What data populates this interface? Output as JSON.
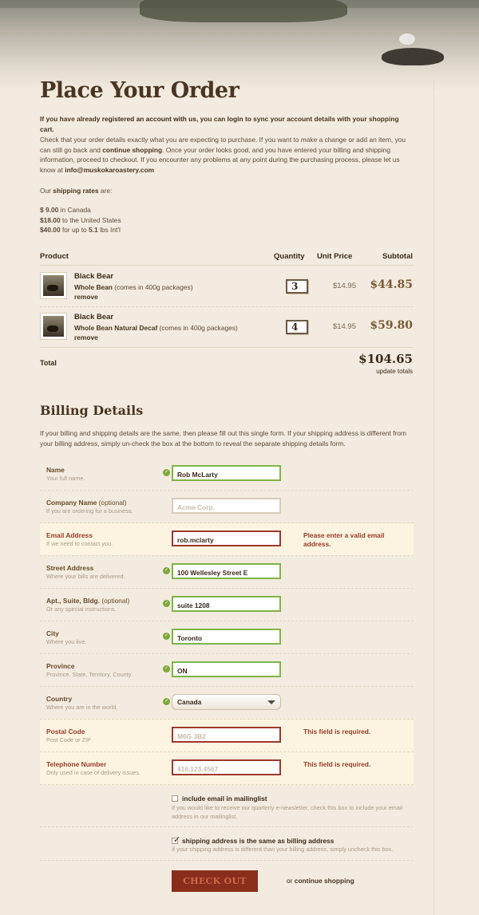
{
  "title": "Place Your Order",
  "intro": {
    "account_pre": "If you have already ",
    "account_link": "registered an account with us",
    "account_mid": ", you can ",
    "account_link2": "login",
    "account_post": " to sync your account details with your shopping cart.",
    "check_pre": "Check that your order details exactly what you are expecting to purchase. If you want to make a change or add an item, you can still go back and ",
    "check_link": "continue shopping",
    "check_mid": ". Once your order looks good, and you have entered your billing and shipping information, proceed to checkout. If you encounter any problems at any point during the purchasing process, please let us know at ",
    "check_email": "info@muskokaroastery.com",
    "rates_pre": "Our ",
    "rates_link": "shipping rates",
    "rates_post": " are:"
  },
  "rates": [
    {
      "amount": "$  9.00",
      "text": " in Canada"
    },
    {
      "amount": "$18.00",
      "text": " to the United States"
    },
    {
      "amount": "$40.00",
      "text": " for up to ",
      "extra": "5.1",
      "tail": " lbs Int'l"
    }
  ],
  "cart": {
    "headers": {
      "product": "Product",
      "quantity": "Quantity",
      "unit_price": "Unit Price",
      "subtotal": "Subtotal"
    },
    "items": [
      {
        "name": "Black Bear",
        "variant": "Whole Bean",
        "note": " (comes in 400g packages)",
        "remove": "remove",
        "qty": "3",
        "unit_price": "$14.95",
        "subtotal": "$44.85"
      },
      {
        "name": "Black Bear",
        "variant": "Whole Bean Natural Decaf",
        "note": " (comes in 400g packages)",
        "remove": "remove",
        "qty": "4",
        "unit_price": "$14.95",
        "subtotal": "$59.80"
      }
    ],
    "total_label": "Total",
    "total": "$104.65",
    "update": "update totals"
  },
  "billing": {
    "title": "Billing Details",
    "intro": "If your billing and shipping details are the same, then please fill out this single form. If your shipping address is different from your billing address, simply un-check the box at the bottom to reveal the separate shipping details form.",
    "fields": [
      {
        "label": "Name",
        "optional": "",
        "hint": "Your full name.",
        "value": "Rob McLarty",
        "state": "good",
        "error": ""
      },
      {
        "label": "Company Name",
        "optional": " (optional)",
        "hint": "If you are ordering for a business.",
        "value": "Acme Corp.",
        "state": "plain",
        "error": ""
      },
      {
        "label": "Email Address",
        "optional": "",
        "hint": "If we need to contact you.",
        "value": "rob.mclarty",
        "state": "bad",
        "error": "Please enter a valid email address."
      },
      {
        "label": "Street Address",
        "optional": "",
        "hint": "Where your bills are delivered.",
        "value": "100 Wellesley Street E",
        "state": "good",
        "error": ""
      },
      {
        "label": "Apt., Suite, Bldg.",
        "optional": " (optional)",
        "hint": "Or any special instructions.",
        "value": "suite 1208",
        "state": "good",
        "error": ""
      },
      {
        "label": "City",
        "optional": "",
        "hint": "Where you live.",
        "value": "Toronto",
        "state": "good",
        "error": ""
      },
      {
        "label": "Province",
        "optional": "",
        "hint": "Province, State, Territory, County.",
        "value": "ON",
        "state": "good",
        "error": ""
      },
      {
        "label": "Country",
        "optional": "",
        "hint": "Where you are in the world.",
        "value": "Canada",
        "state": "select",
        "error": ""
      },
      {
        "label": "Postal Code",
        "optional": "",
        "hint": "Post Code or ZIP",
        "value": "M6G 3B2",
        "state": "bad-ph",
        "error": "This field is required."
      },
      {
        "label": "Telephone Number",
        "optional": "",
        "hint": "Only used in case of delivery issues.",
        "value": "416.123.4567",
        "state": "bad-ph",
        "error": "This field is required."
      }
    ],
    "mailinglist_label": "include email in mailinglist",
    "mailinglist_hint": "If you would like to receive our quarterly e-newsletter, check this box to include your email address in our mailinglist.",
    "mailinglist_checked": false,
    "same_label": "shipping address is the same as billing address",
    "same_hint": "If your shipping address is different than your billing address, simply uncheck this box.",
    "same_checked": true,
    "checkout": "CHECK OUT",
    "or": "or ",
    "continue": "continue shopping"
  },
  "colors": {
    "accent": "#4a3422",
    "error": "#9a3a2a",
    "valid": "#7fb446",
    "button": "#8a2e1c"
  }
}
